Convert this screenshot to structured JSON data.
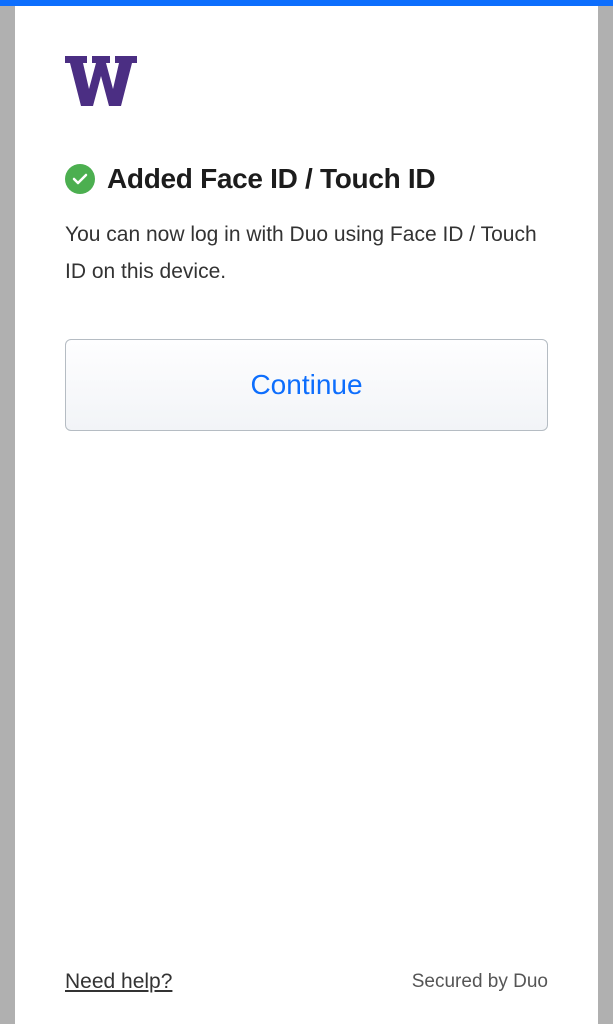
{
  "title": "Added Face ID / Touch ID",
  "description": "You can now log in with Duo using Face ID / Touch ID on this device.",
  "continue_label": "Continue",
  "footer": {
    "help_label": "Need help?",
    "secured_label": "Secured by Duo"
  },
  "colors": {
    "accent": "#0d6efd",
    "success": "#4caf50",
    "brand": "#4b2e83"
  }
}
